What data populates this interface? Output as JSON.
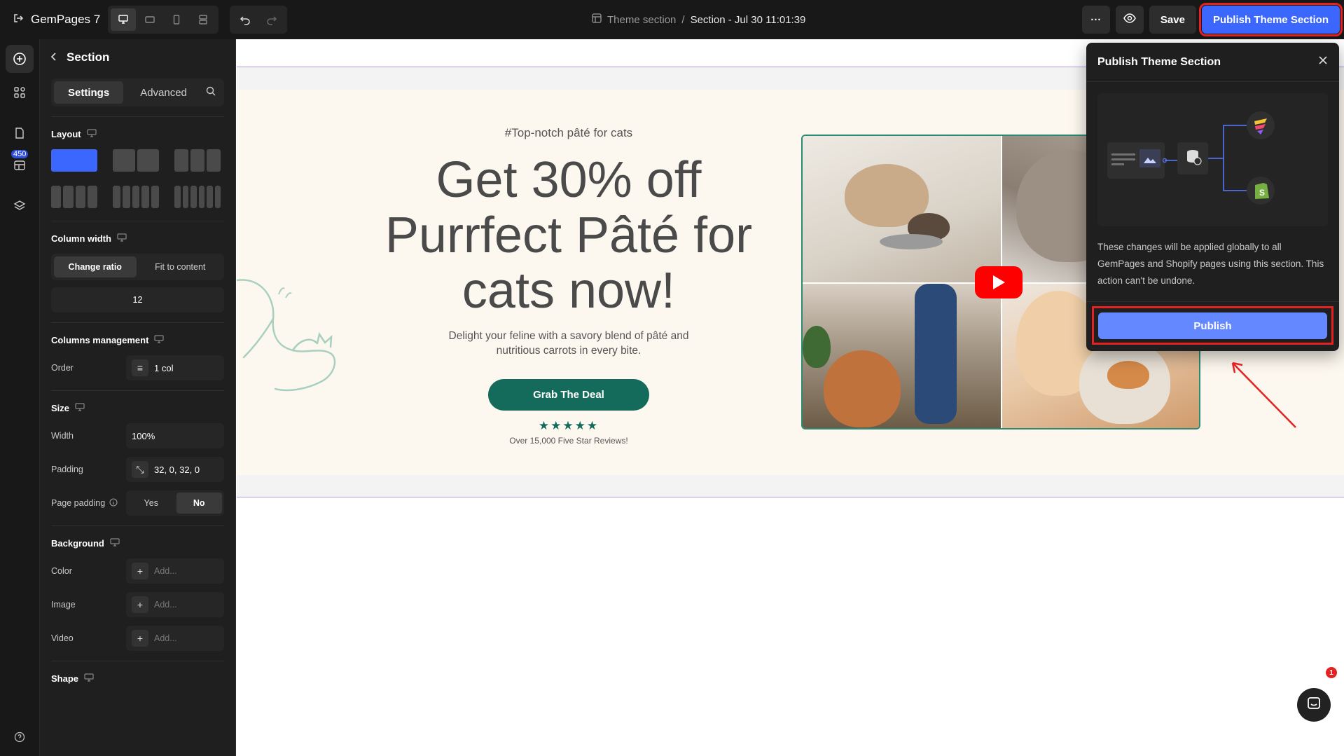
{
  "topbar": {
    "app_name": "GemPages 7",
    "breadcrumb_root": "Theme section",
    "breadcrumb_sep": "/",
    "breadcrumb_current": "Section - Jul 30 11:01:39",
    "more_label": "···",
    "save_label": "Save",
    "publish_label": "Publish Theme Section"
  },
  "rail": {
    "badge_count": "450"
  },
  "panel": {
    "title": "Section",
    "tabs": [
      "Settings",
      "Advanced"
    ],
    "layout_label": "Layout",
    "column_width_label": "Column width",
    "column_width_options": [
      "Change ratio",
      "Fit to content"
    ],
    "column_width_value": "12",
    "columns_mgmt_label": "Columns management",
    "order_label": "Order",
    "order_value": "1 col",
    "size_label": "Size",
    "width_label": "Width",
    "width_value": "100%",
    "padding_label": "Padding",
    "padding_value": "32, 0, 32, 0",
    "page_padding_label": "Page padding",
    "page_padding_options": [
      "Yes",
      "No"
    ],
    "background_label": "Background",
    "color_label": "Color",
    "image_label": "Image",
    "video_label": "Video",
    "add_placeholder": "Add...",
    "shape_label": "Shape"
  },
  "hero": {
    "tag": "#Top-notch pâté for cats",
    "headline": "Get 30% off Purrfect Pâté for cats now!",
    "sub": "Delight your feline with a savory blend of pâté and nutritious carrots in every bite.",
    "cta": "Grab The Deal",
    "stars": "★★★★★",
    "reviews": "Over 15,000 Five Star Reviews!",
    "accent": "#146b5b"
  },
  "popover": {
    "title": "Publish Theme Section",
    "description": "These changes will be applied globally to all GemPages and Shopify pages using this section. This action can't be undone.",
    "button": "Publish"
  },
  "chat": {
    "badge": "1"
  },
  "colors": {
    "brand_blue": "#3c67ff",
    "highlight_red": "#e52222",
    "panel_bg": "#1f1f1f"
  }
}
